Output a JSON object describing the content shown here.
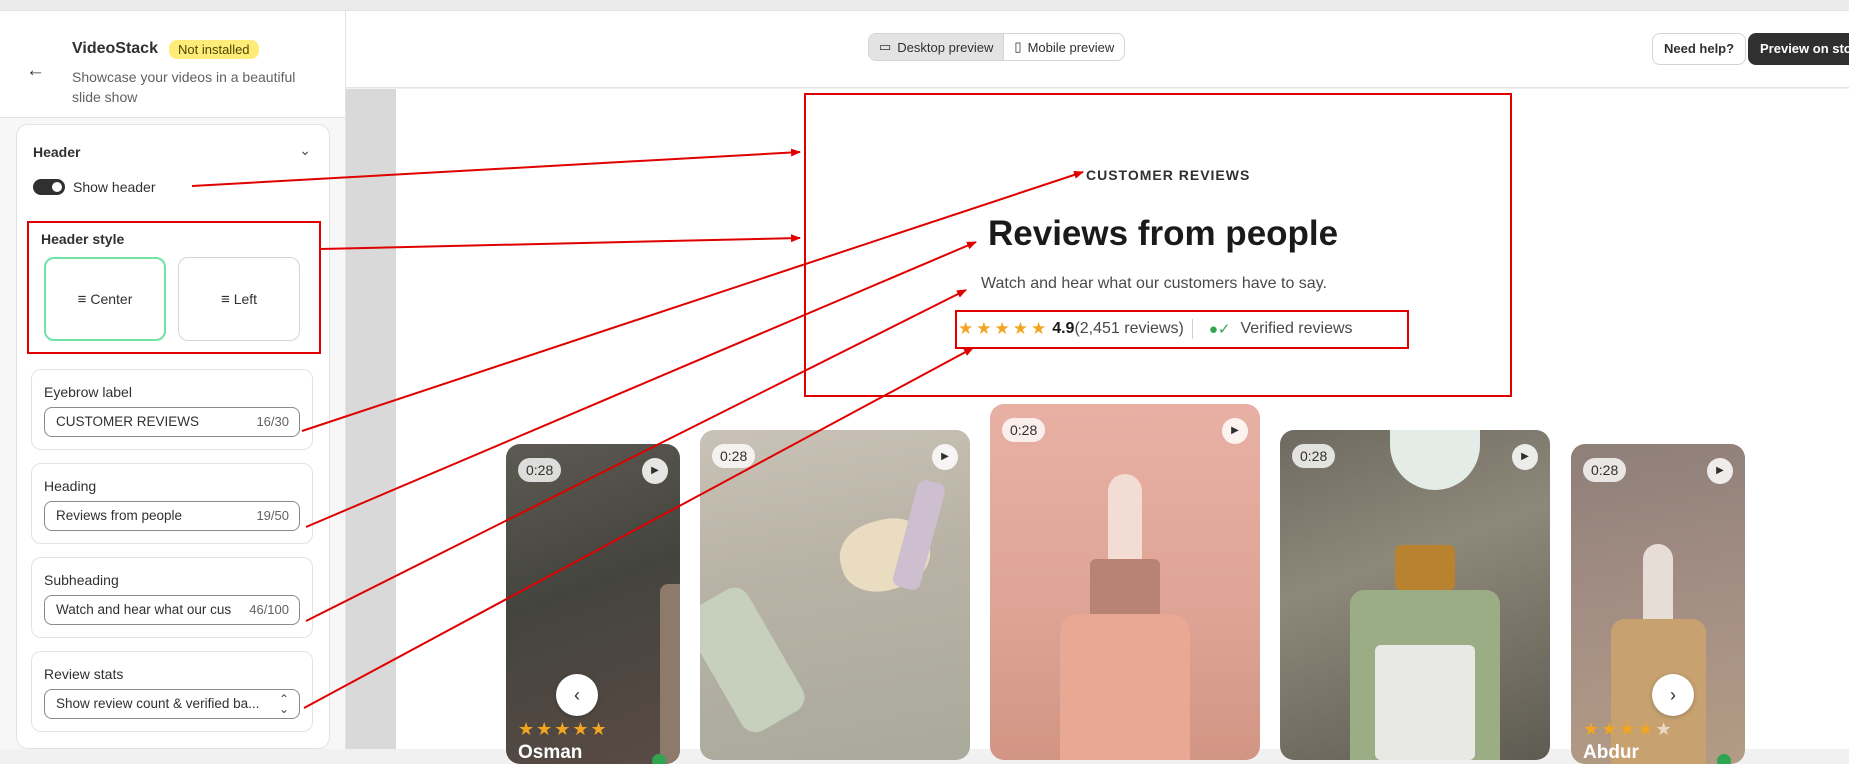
{
  "app": {
    "name": "VideoStack",
    "status_badge": "Not installed",
    "description": "Showcase your videos in a beautiful slide show"
  },
  "icons": {
    "back": "arrow-left-icon",
    "collapse": "chevron-down-icon",
    "desktop": "desktop-icon",
    "mobile": "mobile-icon",
    "align_center": "align-center-icon",
    "align_left": "align-left-icon",
    "star": "star-icon",
    "verified": "verified-user-icon",
    "play": "play-icon",
    "prev": "chevron-left-icon",
    "next": "chevron-right-icon"
  },
  "colors": {
    "badge_bg": "#ffeb78",
    "selected_option_border": "#6fe3a6",
    "star": "#f2a521",
    "verified": "#2fa552",
    "annotation": "#e00000",
    "primary_button": "#303030"
  },
  "settings": {
    "section_title": "Header",
    "show_header_label": "Show header",
    "show_header_enabled": true,
    "header_style": {
      "title": "Header style",
      "options": [
        "Center",
        "Left"
      ],
      "selected": "Center"
    },
    "eyebrow": {
      "label": "Eyebrow label",
      "value": "CUSTOMER REVIEWS",
      "count": "16/30"
    },
    "heading": {
      "label": "Heading",
      "value": "Reviews from people",
      "count": "19/50"
    },
    "subheading": {
      "label": "Subheading",
      "value": "Watch and hear what our cus",
      "count": "46/100"
    },
    "review_stats": {
      "label": "Review stats",
      "value": "Show review count & verified ba..."
    }
  },
  "toolbar": {
    "desktop_preview": "Desktop preview",
    "mobile_preview": "Mobile preview",
    "active_preview": "desktop",
    "need_help": "Need help?",
    "preview_store": "Preview on store"
  },
  "preview": {
    "eyebrow": "CUSTOMER REVIEWS",
    "heading": "Reviews from people",
    "subheading": "Watch and hear what our customers have to say.",
    "stars": 5,
    "rating": "4.9",
    "review_count": "(2,451 reviews)",
    "verified_label": "Verified reviews",
    "videos": [
      {
        "duration": "0:28",
        "name": "Osman",
        "stars": 5
      },
      {
        "duration": "0:28"
      },
      {
        "duration": "0:28"
      },
      {
        "duration": "0:28"
      },
      {
        "duration": "0:28",
        "name": "Abdur",
        "stars": 4
      }
    ]
  }
}
